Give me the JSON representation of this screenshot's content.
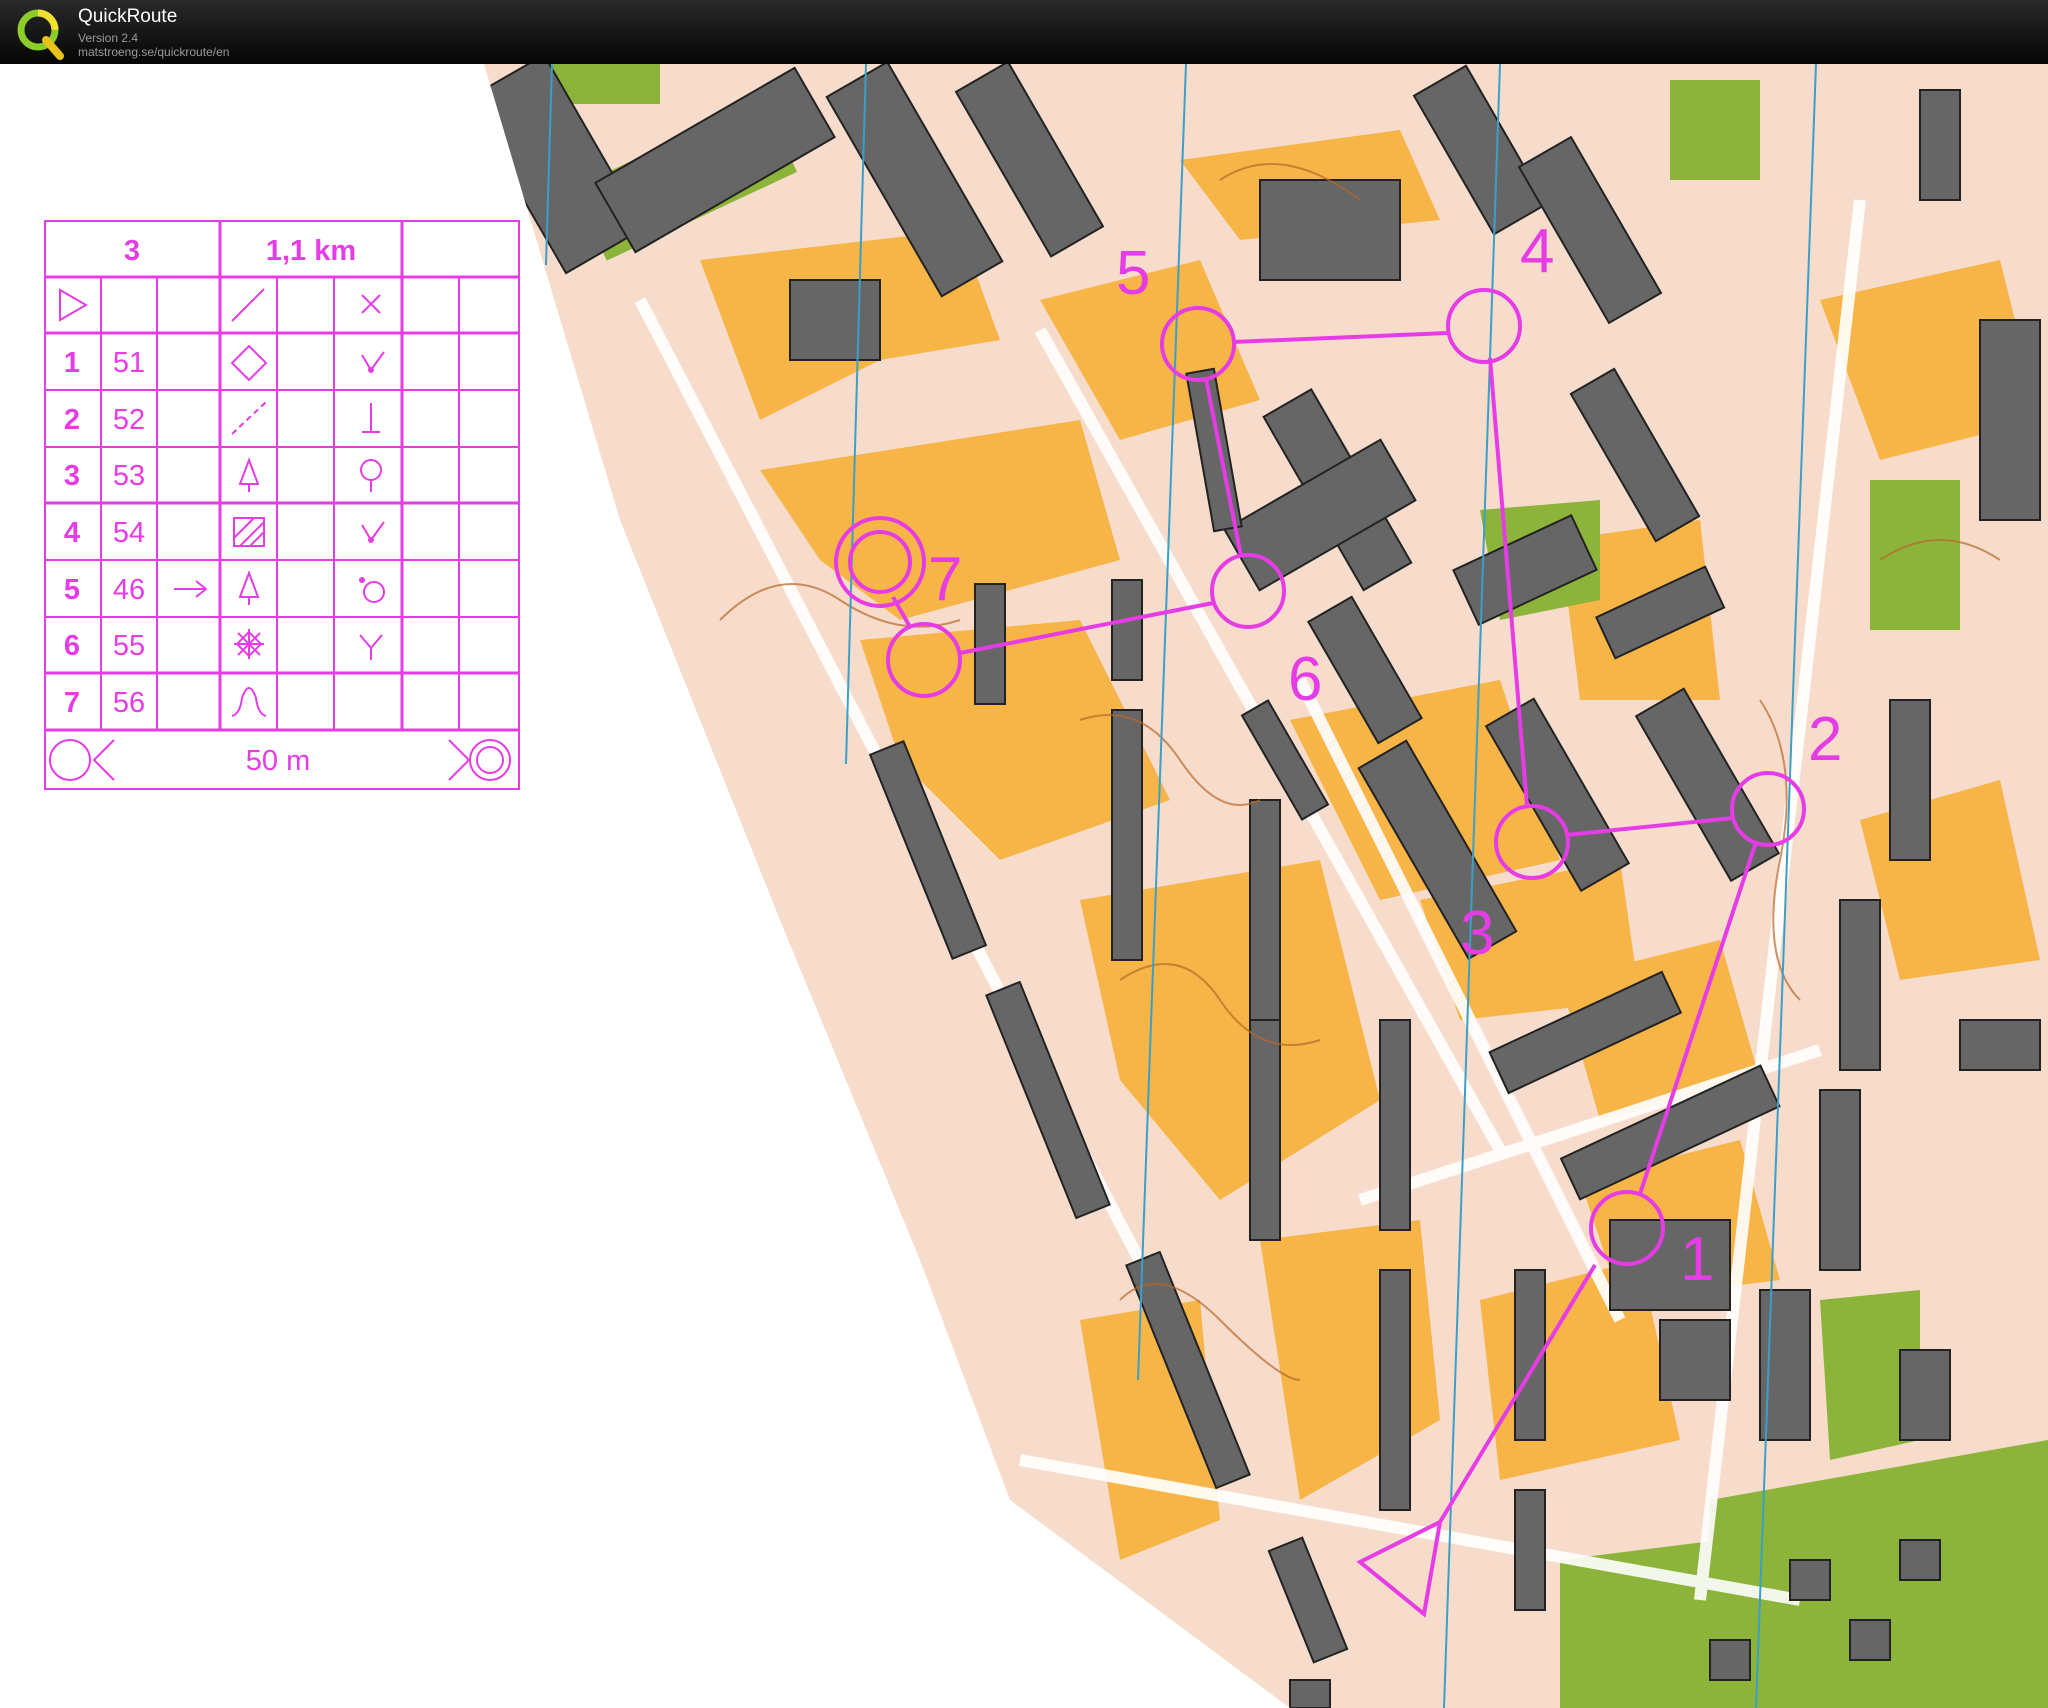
{
  "app": {
    "title": "QuickRoute",
    "version": "Version 2.4",
    "url": "matstroeng.se/quickroute/en"
  },
  "map": {
    "course_color": "#e63ce6",
    "controls": [
      {
        "label": "1"
      },
      {
        "label": "2"
      },
      {
        "label": "3"
      },
      {
        "label": "4"
      },
      {
        "label": "5"
      },
      {
        "label": "6"
      },
      {
        "label": "7"
      }
    ]
  },
  "description_sheet": {
    "course": "3",
    "length": "1,1 km",
    "rows": [
      {
        "no": "1",
        "code": "51"
      },
      {
        "no": "2",
        "code": "52"
      },
      {
        "no": "3",
        "code": "53"
      },
      {
        "no": "4",
        "code": "54"
      },
      {
        "no": "5",
        "code": "46"
      },
      {
        "no": "6",
        "code": "55"
      },
      {
        "no": "7",
        "code": "56"
      }
    ],
    "finish_distance": "50 m"
  }
}
